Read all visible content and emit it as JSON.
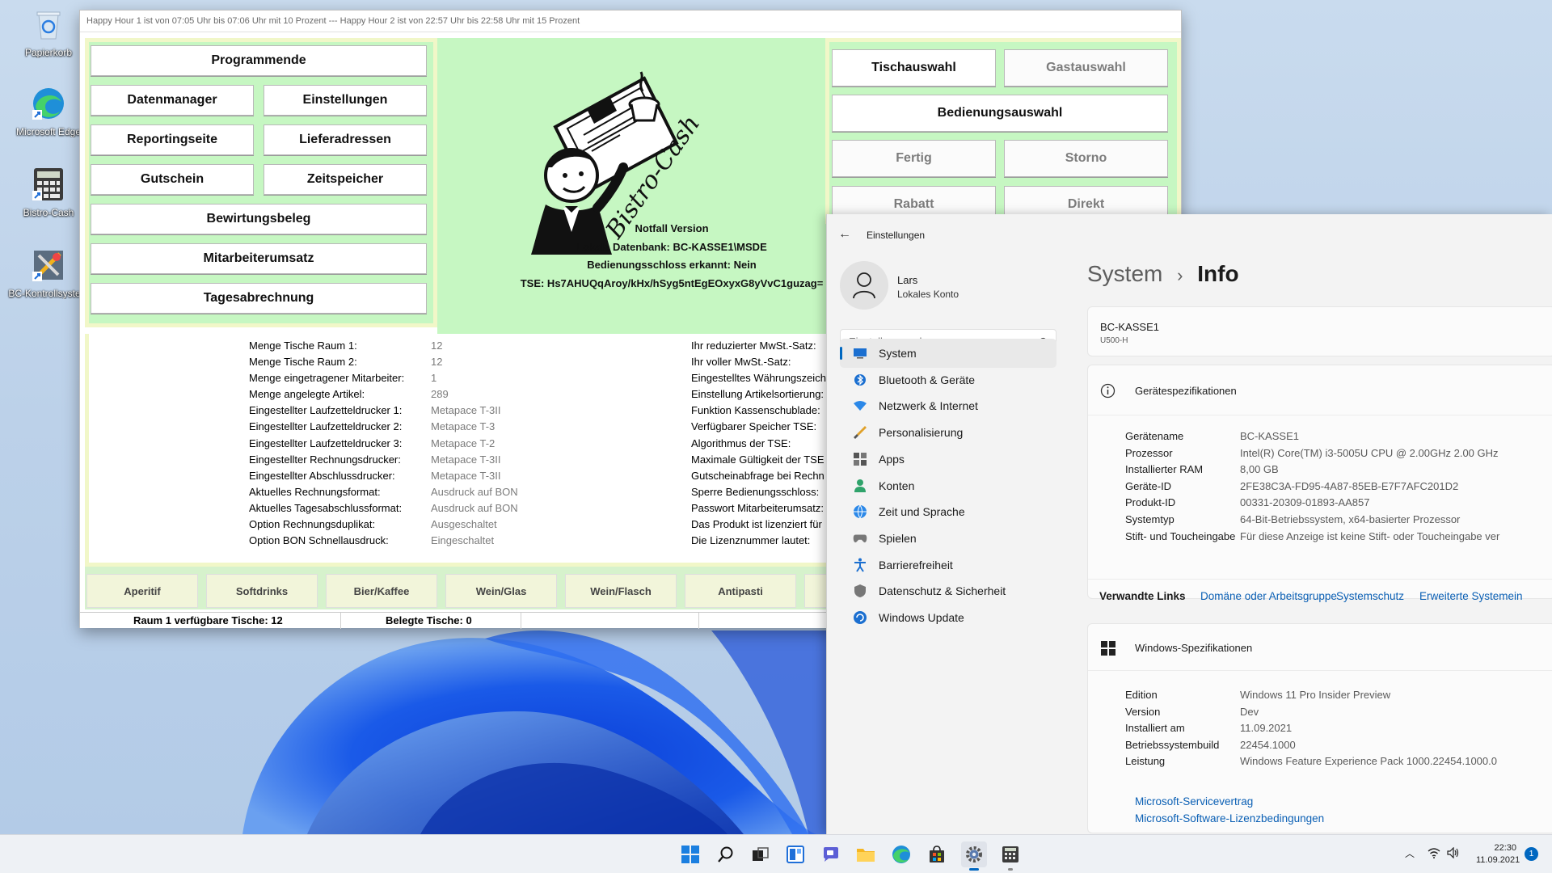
{
  "desktop": {
    "icons": [
      {
        "label": "Papierkorb"
      },
      {
        "label": "Microsoft Edge"
      },
      {
        "label": "Bistro-Cash"
      },
      {
        "label": "BC-Kontrollsystem"
      }
    ]
  },
  "bistro": {
    "title": "Happy Hour 1 ist von 07:05 Uhr bis 07:06 Uhr mit 10 Prozent --- Happy Hour 2 ist von 22:57 Uhr bis 22:58 Uhr mit 15 Prozent",
    "left_buttons": {
      "programmende": "Programmende",
      "datenmanager": "Datenmanager",
      "einstellungen": "Einstellungen",
      "reportingseite": "Reportingseite",
      "lieferadressen": "Lieferadressen",
      "gutschein": "Gutschein",
      "zeitspeicher": "Zeitspeicher",
      "bewirtungsbeleg": "Bewirtungsbeleg",
      "mitarbeiterumsatz": "Mitarbeiterumsatz",
      "tagesabrechnung": "Tagesabrechnung"
    },
    "logo_text": "Bistro-Cash",
    "center_info": {
      "line1": "Notfall Version",
      "line2": "Lokale Datenbank: BC-KASSE1\\MSDE",
      "line3": "Bedienungsschloss erkannt: Nein",
      "line4": "TSE: Hs7AHUQqAroy/kHx/hSyg5ntEgEOxyxG8yVvC1guzag="
    },
    "right_buttons": {
      "tischauswahl": "Tischauswahl",
      "gastauswahl": "Gastauswahl",
      "bedienungsauswahl": "Bedienungsauswahl",
      "fertig": "Fertig",
      "storno": "Storno",
      "rabatt": "Rabatt",
      "direkt": "Direkt"
    },
    "info_labels": [
      "Menge Tische Raum 1:",
      "Menge Tische Raum 2:",
      "Menge eingetragener Mitarbeiter:",
      "Menge angelegte Artikel:",
      "Eingestellter Laufzetteldrucker 1:",
      "Eingestellter Laufzetteldrucker 2:",
      "Eingestellter Laufzetteldrucker 3:",
      "Eingestellter Rechnungsdrucker:",
      "Eingestellter Abschlussdrucker:",
      "Aktuelles Rechnungsformat:",
      "Aktuelles Tagesabschlussformat:",
      "Option Rechnungsduplikat:",
      "Option BON Schnellausdruck:"
    ],
    "info_values": [
      "12",
      "12",
      "1",
      "289",
      "Metapace T-3II",
      "Metapace T-3",
      "Metapace T-2",
      "Metapace T-3II",
      "Metapace T-3II",
      "Ausdruck auf BON",
      "Ausdruck auf BON",
      "Ausgeschaltet",
      "Eingeschaltet"
    ],
    "info_labels_right": [
      "Ihr reduzierter MwSt.-Satz:",
      "Ihr voller MwSt.-Satz:",
      "Eingestelltes Währungszeich",
      "Einstellung Artikelsortierung:",
      "Funktion Kassenschublade:",
      "Verfügbarer Speicher TSE:",
      "Algorithmus der TSE:",
      "Maximale Gültigkeit der TSE",
      "Gutscheinabfrage bei Rechn",
      "Sperre Bedienungsschloss:",
      "Passwort Mitarbeiterumsatz:",
      "Das Produkt ist lizenziert für",
      "Die Lizenznummer lautet:"
    ],
    "categories": [
      "Aperitif",
      "Softdrinks",
      "Bier/Kaffee",
      "Wein/Glas",
      "Wein/Flasch",
      "Antipasti"
    ],
    "status": {
      "raum": "Raum 1 verfügbare Tische: 12",
      "belegt": "Belegte Tische: 0"
    }
  },
  "settings": {
    "window_title": "Einstellungen",
    "user_name": "Lars",
    "user_account": "Lokales Konto",
    "search_placeholder": "Einstellung suchen",
    "nav": [
      {
        "label": "System",
        "icon": "monitor-icon"
      },
      {
        "label": "Bluetooth & Geräte",
        "icon": "bluetooth-icon"
      },
      {
        "label": "Netzwerk & Internet",
        "icon": "wifi-icon"
      },
      {
        "label": "Personalisierung",
        "icon": "brush-icon"
      },
      {
        "label": "Apps",
        "icon": "apps-icon"
      },
      {
        "label": "Konten",
        "icon": "person-icon"
      },
      {
        "label": "Zeit und Sprache",
        "icon": "globe-clock-icon"
      },
      {
        "label": "Spielen",
        "icon": "gamepad-icon"
      },
      {
        "label": "Barrierefreiheit",
        "icon": "accessibility-icon"
      },
      {
        "label": "Datenschutz & Sicherheit",
        "icon": "shield-icon"
      },
      {
        "label": "Windows Update",
        "icon": "update-icon"
      }
    ],
    "breadcrumb_parent": "System",
    "breadcrumb_sep": "›",
    "breadcrumb_current": "Info",
    "device_name": "BC-KASSE1",
    "device_model": "U500-H",
    "device_specs_title": "Gerätespezifikationen",
    "device_specs": [
      {
        "k": "Gerätename",
        "v": "BC-KASSE1"
      },
      {
        "k": "Prozessor",
        "v": "Intel(R) Core(TM) i3-5005U CPU @ 2.00GHz   2.00 GHz"
      },
      {
        "k": "Installierter RAM",
        "v": "8,00 GB"
      },
      {
        "k": "Geräte-ID",
        "v": "2FE38C3A-FD95-4A87-85EB-E7F7AFC201D2"
      },
      {
        "k": "Produkt-ID",
        "v": "00331-20309-01893-AA857"
      },
      {
        "k": "Systemtyp",
        "v": "64-Bit-Betriebssystem, x64-basierter Prozessor"
      },
      {
        "k": "Stift- und Toucheingabe",
        "v": "Für diese Anzeige ist keine Stift- oder Toucheingabe ver"
      }
    ],
    "related_links_label": "Verwandte Links",
    "related_links": [
      "Domäne oder Arbeitsgruppe",
      "Systemschutz",
      "Erweiterte Systemein"
    ],
    "windows_specs_title": "Windows-Spezifikationen",
    "windows_specs": [
      {
        "k": "Edition",
        "v": "Windows 11 Pro Insider Preview"
      },
      {
        "k": "Version",
        "v": "Dev"
      },
      {
        "k": "Installiert am",
        "v": "11.09.2021"
      },
      {
        "k": "Betriebssystembuild",
        "v": "22454.1000"
      },
      {
        "k": "Leistung",
        "v": "Windows Feature Experience Pack 1000.22454.1000.0"
      }
    ],
    "windows_links": [
      "Microsoft-Servicevertrag",
      "Microsoft-Software-Lizenzbedingungen"
    ]
  },
  "taskbar": {
    "time": "22:30",
    "date": "11.09.2021",
    "notification_count": "1"
  },
  "colors": {
    "bistro_green": "#c6f7c2",
    "bistro_border": "#f1f7c8",
    "accent_blue": "#0067c0",
    "link_blue": "#0a5fb4"
  }
}
